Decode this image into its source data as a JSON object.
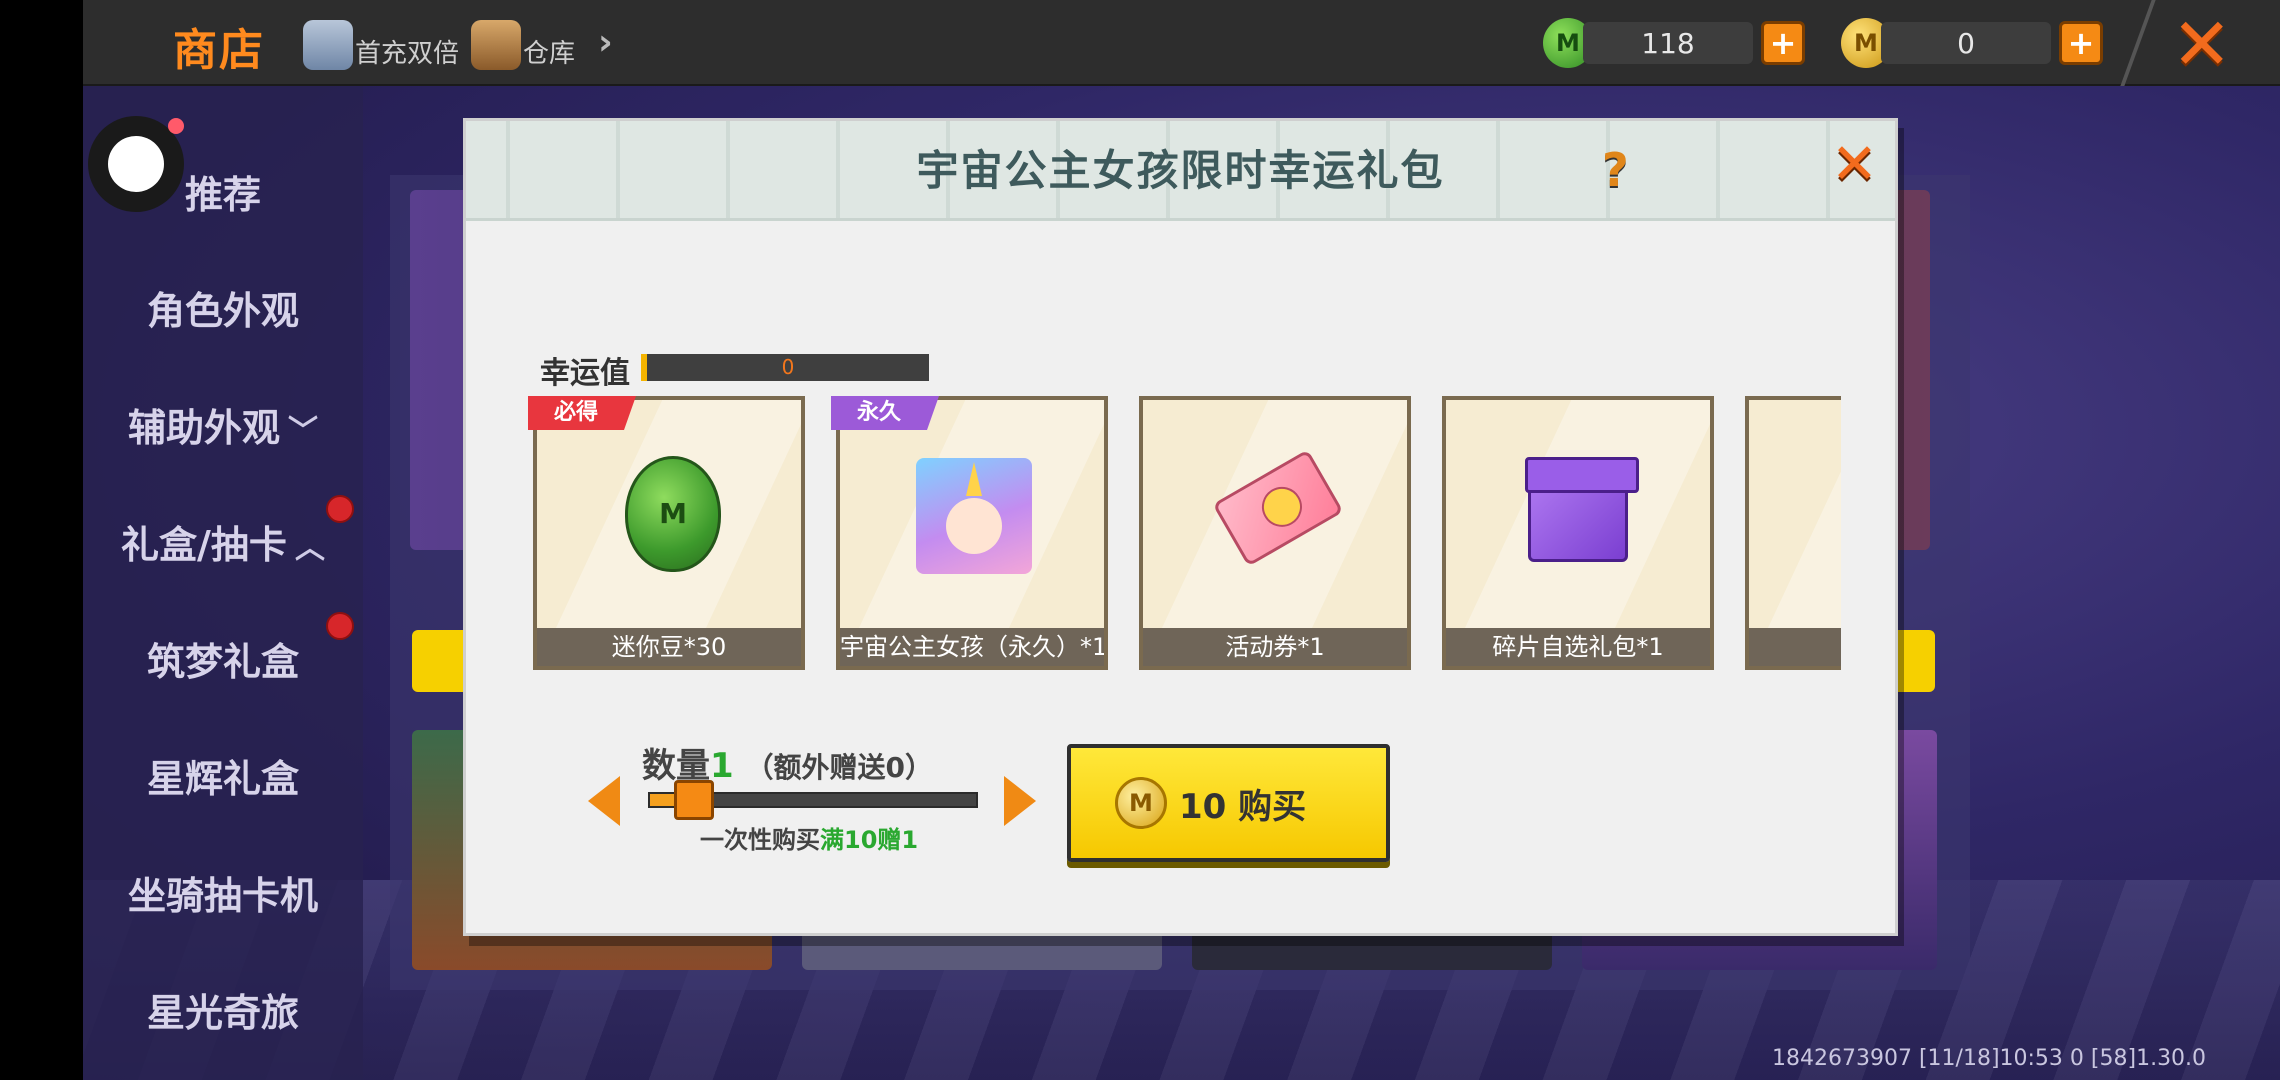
{
  "topbar": {
    "shop_title": "商店",
    "tabs": [
      {
        "label": "首充双倍",
        "icon": "piggy-icon"
      },
      {
        "label": "仓库",
        "icon": "warehouse-icon"
      }
    ],
    "more_arrow": "›",
    "currencies": [
      {
        "name": "mini-bean",
        "value": "118",
        "color": "#3d9a2c"
      },
      {
        "name": "mini-coin",
        "value": "0",
        "color": "#d9a314"
      }
    ],
    "plus_symbol": "+",
    "close_symbol": "✕"
  },
  "sidebar": {
    "items": [
      {
        "label": "推荐"
      },
      {
        "label": "角色外观"
      },
      {
        "label": "辅助外观",
        "chevron": "﹀"
      },
      {
        "label": "礼盒/抽卡",
        "chevron": "︿"
      },
      {
        "label": "筑梦礼盒"
      },
      {
        "label": "星辉礼盒"
      },
      {
        "label": "坐骑抽卡机"
      },
      {
        "label": "星光奇旅"
      }
    ]
  },
  "dialog": {
    "title": "宇宙公主女孩限时幸运礼包",
    "help_symbol": "?",
    "close_symbol": "✕",
    "luck": {
      "label": "幸运值",
      "value": "0"
    },
    "items": [
      {
        "tag": "必得",
        "tag_color": "#e8363e",
        "caption": "迷你豆*30",
        "icon": "mini-bean-icon",
        "icon_letter": "M"
      },
      {
        "tag": "永久",
        "tag_color": "#9c5ad8",
        "caption": "宇宙公主女孩（永久）*1",
        "icon": "princess-avatar-icon"
      },
      {
        "caption": "活动券*1",
        "icon": "event-ticket-icon"
      },
      {
        "caption": "碎片自选礼包*1",
        "icon": "fragment-gift-box-icon"
      }
    ],
    "quantity": {
      "label": "数量",
      "value": "1",
      "extra_open": "（额外赠送",
      "extra_value": "0",
      "extra_close": "）",
      "slider_fraction": 0.08,
      "promo_prefix": "一次性购买",
      "promo_highlight": "满10赠1"
    },
    "buy_button": {
      "coin_letter": "M",
      "price": "10",
      "label": "购买"
    }
  },
  "footer": {
    "uid_line": "1842673907    [11/18]10:53 0   [58]1.30.0"
  }
}
